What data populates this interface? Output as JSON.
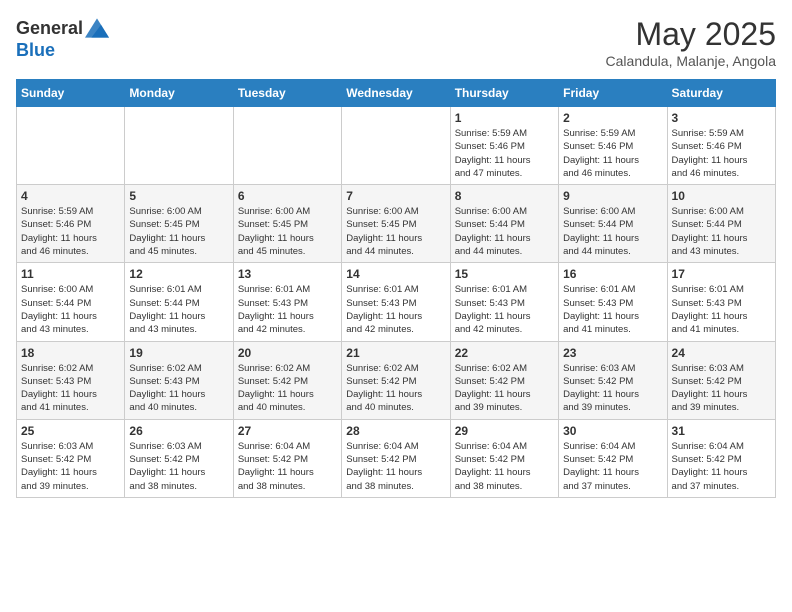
{
  "header": {
    "logo_general": "General",
    "logo_blue": "Blue",
    "month_title": "May 2025",
    "subtitle": "Calandula, Malanje, Angola"
  },
  "weekdays": [
    "Sunday",
    "Monday",
    "Tuesday",
    "Wednesday",
    "Thursday",
    "Friday",
    "Saturday"
  ],
  "weeks": [
    [
      {
        "day": null,
        "info": null
      },
      {
        "day": null,
        "info": null
      },
      {
        "day": null,
        "info": null
      },
      {
        "day": null,
        "info": null
      },
      {
        "day": "1",
        "info": "Sunrise: 5:59 AM\nSunset: 5:46 PM\nDaylight: 11 hours\nand 47 minutes."
      },
      {
        "day": "2",
        "info": "Sunrise: 5:59 AM\nSunset: 5:46 PM\nDaylight: 11 hours\nand 46 minutes."
      },
      {
        "day": "3",
        "info": "Sunrise: 5:59 AM\nSunset: 5:46 PM\nDaylight: 11 hours\nand 46 minutes."
      }
    ],
    [
      {
        "day": "4",
        "info": "Sunrise: 5:59 AM\nSunset: 5:46 PM\nDaylight: 11 hours\nand 46 minutes."
      },
      {
        "day": "5",
        "info": "Sunrise: 6:00 AM\nSunset: 5:45 PM\nDaylight: 11 hours\nand 45 minutes."
      },
      {
        "day": "6",
        "info": "Sunrise: 6:00 AM\nSunset: 5:45 PM\nDaylight: 11 hours\nand 45 minutes."
      },
      {
        "day": "7",
        "info": "Sunrise: 6:00 AM\nSunset: 5:45 PM\nDaylight: 11 hours\nand 44 minutes."
      },
      {
        "day": "8",
        "info": "Sunrise: 6:00 AM\nSunset: 5:44 PM\nDaylight: 11 hours\nand 44 minutes."
      },
      {
        "day": "9",
        "info": "Sunrise: 6:00 AM\nSunset: 5:44 PM\nDaylight: 11 hours\nand 44 minutes."
      },
      {
        "day": "10",
        "info": "Sunrise: 6:00 AM\nSunset: 5:44 PM\nDaylight: 11 hours\nand 43 minutes."
      }
    ],
    [
      {
        "day": "11",
        "info": "Sunrise: 6:00 AM\nSunset: 5:44 PM\nDaylight: 11 hours\nand 43 minutes."
      },
      {
        "day": "12",
        "info": "Sunrise: 6:01 AM\nSunset: 5:44 PM\nDaylight: 11 hours\nand 43 minutes."
      },
      {
        "day": "13",
        "info": "Sunrise: 6:01 AM\nSunset: 5:43 PM\nDaylight: 11 hours\nand 42 minutes."
      },
      {
        "day": "14",
        "info": "Sunrise: 6:01 AM\nSunset: 5:43 PM\nDaylight: 11 hours\nand 42 minutes."
      },
      {
        "day": "15",
        "info": "Sunrise: 6:01 AM\nSunset: 5:43 PM\nDaylight: 11 hours\nand 42 minutes."
      },
      {
        "day": "16",
        "info": "Sunrise: 6:01 AM\nSunset: 5:43 PM\nDaylight: 11 hours\nand 41 minutes."
      },
      {
        "day": "17",
        "info": "Sunrise: 6:01 AM\nSunset: 5:43 PM\nDaylight: 11 hours\nand 41 minutes."
      }
    ],
    [
      {
        "day": "18",
        "info": "Sunrise: 6:02 AM\nSunset: 5:43 PM\nDaylight: 11 hours\nand 41 minutes."
      },
      {
        "day": "19",
        "info": "Sunrise: 6:02 AM\nSunset: 5:43 PM\nDaylight: 11 hours\nand 40 minutes."
      },
      {
        "day": "20",
        "info": "Sunrise: 6:02 AM\nSunset: 5:42 PM\nDaylight: 11 hours\nand 40 minutes."
      },
      {
        "day": "21",
        "info": "Sunrise: 6:02 AM\nSunset: 5:42 PM\nDaylight: 11 hours\nand 40 minutes."
      },
      {
        "day": "22",
        "info": "Sunrise: 6:02 AM\nSunset: 5:42 PM\nDaylight: 11 hours\nand 39 minutes."
      },
      {
        "day": "23",
        "info": "Sunrise: 6:03 AM\nSunset: 5:42 PM\nDaylight: 11 hours\nand 39 minutes."
      },
      {
        "day": "24",
        "info": "Sunrise: 6:03 AM\nSunset: 5:42 PM\nDaylight: 11 hours\nand 39 minutes."
      }
    ],
    [
      {
        "day": "25",
        "info": "Sunrise: 6:03 AM\nSunset: 5:42 PM\nDaylight: 11 hours\nand 39 minutes."
      },
      {
        "day": "26",
        "info": "Sunrise: 6:03 AM\nSunset: 5:42 PM\nDaylight: 11 hours\nand 38 minutes."
      },
      {
        "day": "27",
        "info": "Sunrise: 6:04 AM\nSunset: 5:42 PM\nDaylight: 11 hours\nand 38 minutes."
      },
      {
        "day": "28",
        "info": "Sunrise: 6:04 AM\nSunset: 5:42 PM\nDaylight: 11 hours\nand 38 minutes."
      },
      {
        "day": "29",
        "info": "Sunrise: 6:04 AM\nSunset: 5:42 PM\nDaylight: 11 hours\nand 38 minutes."
      },
      {
        "day": "30",
        "info": "Sunrise: 6:04 AM\nSunset: 5:42 PM\nDaylight: 11 hours\nand 37 minutes."
      },
      {
        "day": "31",
        "info": "Sunrise: 6:04 AM\nSunset: 5:42 PM\nDaylight: 11 hours\nand 37 minutes."
      }
    ]
  ]
}
